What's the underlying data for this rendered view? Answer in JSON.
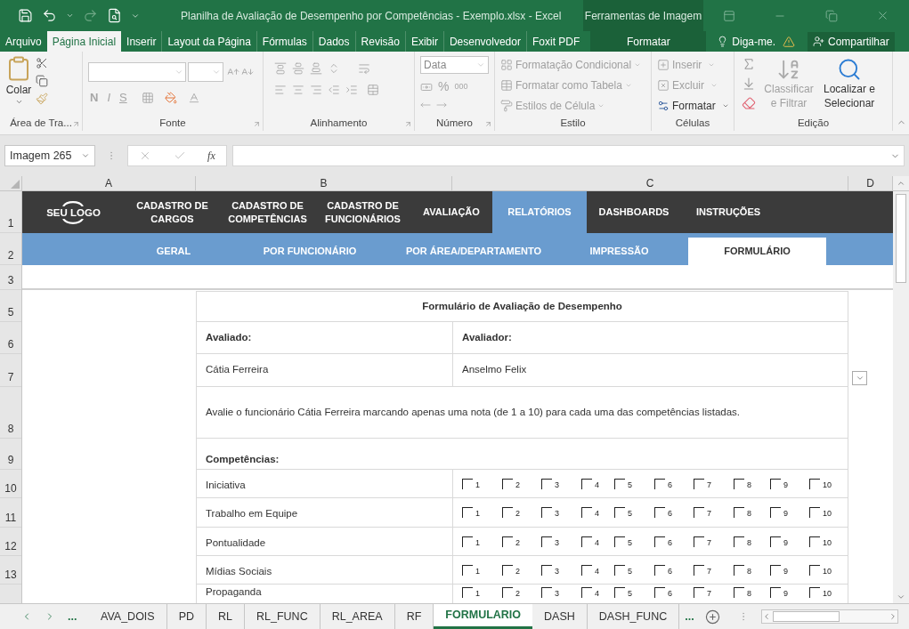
{
  "window": {
    "title": "Planilha de Avaliação de Desempenho por Competências - Exemplo.xlsx - Excel",
    "context_label": "Ferramentas de Imagem"
  },
  "ribbon_tabs": [
    {
      "label": "Arquivo",
      "selected": false,
      "kind": "normal"
    },
    {
      "label": "Página Inicial",
      "selected": true,
      "kind": "normal"
    },
    {
      "label": "Inserir",
      "selected": false,
      "kind": "normal"
    },
    {
      "label": "Layout da Página",
      "selected": false,
      "kind": "normal"
    },
    {
      "label": "Fórmulas",
      "selected": false,
      "kind": "normal"
    },
    {
      "label": "Dados",
      "selected": false,
      "kind": "normal"
    },
    {
      "label": "Revisão",
      "selected": false,
      "kind": "normal"
    },
    {
      "label": "Exibir",
      "selected": false,
      "kind": "normal"
    },
    {
      "label": "Desenvolvedor",
      "selected": false,
      "kind": "normal"
    },
    {
      "label": "Foxit PDF",
      "selected": false,
      "kind": "normal"
    },
    {
      "label": "Formatar",
      "selected": false,
      "kind": "contextual"
    }
  ],
  "tell_me": "Diga-me.",
  "share": "Compartilhar",
  "ribbon_groups": [
    {
      "kind": "clipboard",
      "label": "Área de Tra...",
      "paste": "Colar"
    },
    {
      "kind": "font",
      "label": "Fonte",
      "buttons": [
        "N",
        "I",
        "S"
      ]
    },
    {
      "kind": "alignment",
      "label": "Alinhamento"
    },
    {
      "kind": "number",
      "label": "Número",
      "format": "Data",
      "symbols": [
        "%",
        "000"
      ]
    },
    {
      "kind": "styles",
      "label": "Estilo",
      "commands": [
        {
          "label": "Formatação Condicional",
          "disabled": true
        },
        {
          "label": "Formatar como Tabela",
          "disabled": true
        },
        {
          "label": "Estilos de Célula",
          "disabled": true
        }
      ]
    },
    {
      "kind": "cells",
      "label": "Células",
      "commands": [
        {
          "label": "Inserir",
          "disabled": true
        },
        {
          "label": "Excluir",
          "disabled": true
        },
        {
          "label": "Formatar",
          "disabled": false
        }
      ]
    },
    {
      "kind": "editing",
      "label": "Edição",
      "commands": [
        {
          "label": "Classificar e Filtrar",
          "disabled": true
        },
        {
          "label": "Localizar e Selecionar",
          "disabled": false
        }
      ]
    }
  ],
  "formula_bar": {
    "name_box": "Imagem 265",
    "fx": "fx"
  },
  "columns": [
    "A",
    "B",
    "C",
    "D"
  ],
  "row_numbers": [
    "1",
    "2",
    "3",
    "5",
    "6",
    "7",
    "8",
    "9",
    "10",
    "11",
    "12",
    "13"
  ],
  "nav": {
    "logo": "SEU LOGO",
    "items": [
      {
        "label": "CADASTRO DE CARGOS",
        "selected": false
      },
      {
        "label": "CADASTRO DE COMPETÊNCIAS",
        "selected": false
      },
      {
        "label": "CADASTRO DE FUNCIONÁRIOS",
        "selected": false
      },
      {
        "label": "AVALIAÇÃO",
        "selected": false
      },
      {
        "label": "RELATÓRIOS",
        "selected": true
      },
      {
        "label": "DASHBOARDS",
        "selected": false
      },
      {
        "label": "INSTRUÇÕES",
        "selected": false
      }
    ],
    "subitems": [
      {
        "label": "GERAL",
        "selected": false
      },
      {
        "label": "POR FUNCIONÁRIO",
        "selected": false
      },
      {
        "label": "POR ÁREA/DEPARTAMENTO",
        "selected": false
      },
      {
        "label": "IMPRESSÃO",
        "selected": false
      },
      {
        "label": "FORMULÁRIO",
        "selected": true
      }
    ]
  },
  "form": {
    "title": "Formulário de Avaliação de Desempenho",
    "evaluated_label": "Avaliado:",
    "evaluator_label": "Avaliador:",
    "evaluated": "Cátia Ferreira",
    "evaluator": "Anselmo Felix",
    "instructions": "Avalie o funcionário Cátia Ferreira marcando apenas uma nota (de 1 a 10) para cada uma das competências listadas.",
    "competencies_label": "Competências:",
    "competencies": [
      {
        "name": "Iniciativa",
        "options": [
          {
            "label": "1",
            "checked": false
          },
          {
            "label": "2",
            "checked": false
          },
          {
            "label": "3",
            "checked": false
          },
          {
            "label": "4",
            "checked": false
          },
          {
            "label": "5",
            "checked": false
          },
          {
            "label": "6",
            "checked": false
          },
          {
            "label": "7",
            "checked": false
          },
          {
            "label": "8",
            "checked": false
          },
          {
            "label": "9",
            "checked": false
          },
          {
            "label": "10",
            "checked": false
          }
        ]
      },
      {
        "name": "Trabalho em Equipe",
        "options": [
          {
            "label": "1",
            "checked": false
          },
          {
            "label": "2",
            "checked": false
          },
          {
            "label": "3",
            "checked": false
          },
          {
            "label": "4",
            "checked": false
          },
          {
            "label": "5",
            "checked": false
          },
          {
            "label": "6",
            "checked": false
          },
          {
            "label": "7",
            "checked": false
          },
          {
            "label": "8",
            "checked": false
          },
          {
            "label": "9",
            "checked": false
          },
          {
            "label": "10",
            "checked": false
          }
        ]
      },
      {
        "name": "Pontualidade",
        "options": [
          {
            "label": "1",
            "checked": false
          },
          {
            "label": "2",
            "checked": false
          },
          {
            "label": "3",
            "checked": false
          },
          {
            "label": "4",
            "checked": false
          },
          {
            "label": "5",
            "checked": false
          },
          {
            "label": "6",
            "checked": false
          },
          {
            "label": "7",
            "checked": false
          },
          {
            "label": "8",
            "checked": false
          },
          {
            "label": "9",
            "checked": false
          },
          {
            "label": "10",
            "checked": false
          }
        ]
      },
      {
        "name": "Mídias Sociais",
        "options": [
          {
            "label": "1",
            "checked": false
          },
          {
            "label": "2",
            "checked": false
          },
          {
            "label": "3",
            "checked": false
          },
          {
            "label": "4",
            "checked": false
          },
          {
            "label": "5",
            "checked": false
          },
          {
            "label": "6",
            "checked": false
          },
          {
            "label": "7",
            "checked": false
          },
          {
            "label": "8",
            "checked": false
          },
          {
            "label": "9",
            "checked": false
          },
          {
            "label": "10",
            "checked": false
          }
        ]
      },
      {
        "name": "Propaganda",
        "options": [
          {
            "label": "1",
            "checked": false
          },
          {
            "label": "2",
            "checked": false
          },
          {
            "label": "3",
            "checked": false
          },
          {
            "label": "4",
            "checked": false
          },
          {
            "label": "5",
            "checked": false
          },
          {
            "label": "6",
            "checked": false
          },
          {
            "label": "7",
            "checked": false
          },
          {
            "label": "8",
            "checked": false
          },
          {
            "label": "9",
            "checked": false
          },
          {
            "label": "10",
            "checked": false
          }
        ]
      }
    ]
  },
  "sheet_tabs": [
    {
      "label": "AVA_DOIS",
      "selected": false
    },
    {
      "label": "PD",
      "selected": false
    },
    {
      "label": "RL",
      "selected": false
    },
    {
      "label": "RL_FUNC",
      "selected": false
    },
    {
      "label": "RL_AREA",
      "selected": false
    },
    {
      "label": "RF",
      "selected": false
    },
    {
      "label": "FORMULARIO",
      "selected": true
    },
    {
      "label": "DASH",
      "selected": false
    },
    {
      "label": "DASH_FUNC",
      "selected": false
    }
  ],
  "sheet_more": [
    "...",
    "..."
  ]
}
